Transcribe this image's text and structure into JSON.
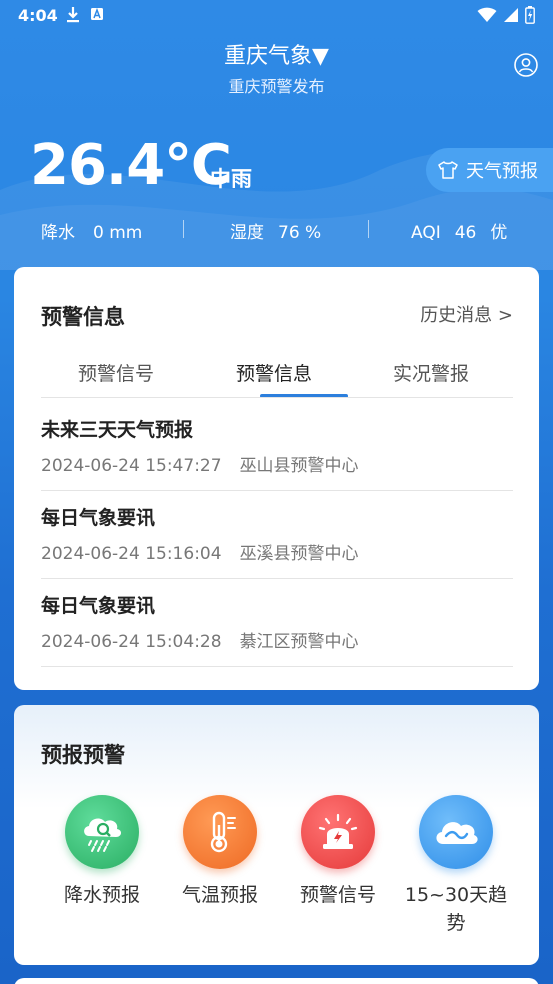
{
  "status": {
    "time": "4:04"
  },
  "header": {
    "city": "重庆气象▼",
    "subtitle": "重庆预警发布"
  },
  "weather": {
    "temperature": "26.4℃",
    "condition": "中雨",
    "forecast_button": "天气预报",
    "stats": [
      {
        "label": "降水",
        "value": "0 mm"
      },
      {
        "label": "湿度",
        "value": "76 %"
      },
      {
        "label": "AQI",
        "value": "46",
        "level": "优"
      }
    ]
  },
  "alerts_card": {
    "title": "预警信息",
    "history_link": "历史消息 >",
    "tabs": [
      "预警信号",
      "预警信息",
      "实况警报"
    ],
    "active_tab": 1,
    "items": [
      {
        "title": "未来三天天气预报",
        "time": "2024-06-24 15:47:27",
        "org": "巫山县预警中心"
      },
      {
        "title": "每日气象要讯",
        "time": "2024-06-24 15:16:04",
        "org": "巫溪县预警中心"
      },
      {
        "title": "每日气象要讯",
        "time": "2024-06-24 15:04:28",
        "org": "綦江区预警中心"
      }
    ]
  },
  "forecast_card": {
    "title": "预报预警",
    "items": [
      {
        "label": "降水预报",
        "icon": "rain-cloud-icon",
        "color": "#3cc27a"
      },
      {
        "label": "气温预报",
        "icon": "thermometer-icon",
        "color": "#f47a2c"
      },
      {
        "label": "预警信号",
        "icon": "alarm-light-icon",
        "color": "#ee4b4b"
      },
      {
        "label": "15~30天趋势",
        "icon": "cloud-trend-icon",
        "color": "#3d9cf0"
      }
    ]
  }
}
